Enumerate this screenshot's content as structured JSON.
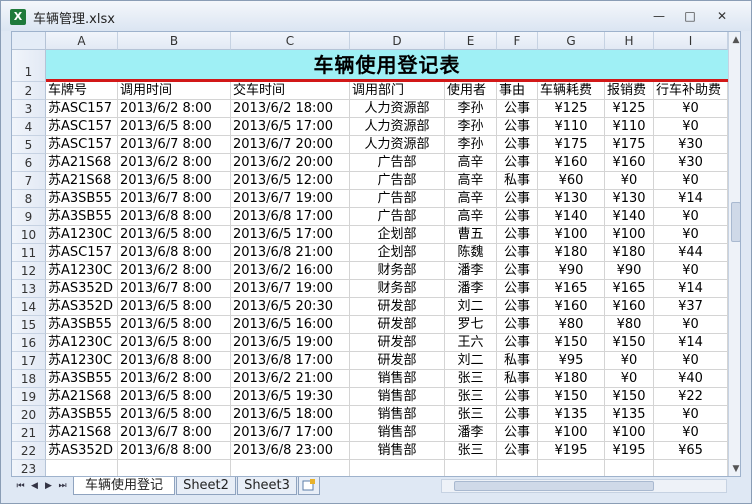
{
  "window": {
    "title": "车辆管理.xlsx",
    "app_icon": "excel-icon",
    "buttons": {
      "minimize": "—",
      "maximize": "□",
      "close": "✕"
    }
  },
  "columns": [
    "A",
    "B",
    "C",
    "D",
    "E",
    "F",
    "G",
    "H",
    "I"
  ],
  "sheet_title": "车辆使用登记表",
  "headers": [
    "车牌号",
    "调用时间",
    "交车时间",
    "调用部门",
    "使用者",
    "事由",
    "车辆耗费",
    "报销费",
    "行车补助费"
  ],
  "rows": [
    [
      "苏ASC157",
      "2013/6/2 8:00",
      "2013/6/2 18:00",
      "人力资源部",
      "李孙",
      "公事",
      "¥125",
      "¥125",
      "¥0"
    ],
    [
      "苏ASC157",
      "2013/6/5 8:00",
      "2013/6/5 17:00",
      "人力资源部",
      "李孙",
      "公事",
      "¥110",
      "¥110",
      "¥0"
    ],
    [
      "苏ASC157",
      "2013/6/7 8:00",
      "2013/6/7 20:00",
      "人力资源部",
      "李孙",
      "公事",
      "¥175",
      "¥175",
      "¥30"
    ],
    [
      "苏A21S68",
      "2013/6/2 8:00",
      "2013/6/2 20:00",
      "广告部",
      "高辛",
      "公事",
      "¥160",
      "¥160",
      "¥30"
    ],
    [
      "苏A21S68",
      "2013/6/5 8:00",
      "2013/6/5 12:00",
      "广告部",
      "高辛",
      "私事",
      "¥60",
      "¥0",
      "¥0"
    ],
    [
      "苏A3SB55",
      "2013/6/7 8:00",
      "2013/6/7 19:00",
      "广告部",
      "高辛",
      "公事",
      "¥130",
      "¥130",
      "¥14"
    ],
    [
      "苏A3SB55",
      "2013/6/8 8:00",
      "2013/6/8 17:00",
      "广告部",
      "高辛",
      "公事",
      "¥140",
      "¥140",
      "¥0"
    ],
    [
      "苏A1230C",
      "2013/6/5 8:00",
      "2013/6/5 17:00",
      "企划部",
      "曹五",
      "公事",
      "¥100",
      "¥100",
      "¥0"
    ],
    [
      "苏ASC157",
      "2013/6/8 8:00",
      "2013/6/8 21:00",
      "企划部",
      "陈魏",
      "公事",
      "¥180",
      "¥180",
      "¥44"
    ],
    [
      "苏A1230C",
      "2013/6/2 8:00",
      "2013/6/2 16:00",
      "财务部",
      "潘李",
      "公事",
      "¥90",
      "¥90",
      "¥0"
    ],
    [
      "苏AS352D",
      "2013/6/7 8:00",
      "2013/6/7 19:00",
      "财务部",
      "潘李",
      "公事",
      "¥165",
      "¥165",
      "¥14"
    ],
    [
      "苏AS352D",
      "2013/6/5 8:00",
      "2013/6/5 20:30",
      "研发部",
      "刘二",
      "公事",
      "¥160",
      "¥160",
      "¥37"
    ],
    [
      "苏A3SB55",
      "2013/6/5 8:00",
      "2013/6/5 16:00",
      "研发部",
      "罗七",
      "公事",
      "¥80",
      "¥80",
      "¥0"
    ],
    [
      "苏A1230C",
      "2013/6/5 8:00",
      "2013/6/5 19:00",
      "研发部",
      "王六",
      "公事",
      "¥150",
      "¥150",
      "¥14"
    ],
    [
      "苏A1230C",
      "2013/6/8 8:00",
      "2013/6/8 17:00",
      "研发部",
      "刘二",
      "私事",
      "¥95",
      "¥0",
      "¥0"
    ],
    [
      "苏A3SB55",
      "2013/6/2 8:00",
      "2013/6/2 21:00",
      "销售部",
      "张三",
      "私事",
      "¥180",
      "¥0",
      "¥40"
    ],
    [
      "苏A21S68",
      "2013/6/5 8:00",
      "2013/6/5 19:30",
      "销售部",
      "张三",
      "公事",
      "¥150",
      "¥150",
      "¥22"
    ],
    [
      "苏A3SB55",
      "2013/6/5 8:00",
      "2013/6/5 18:00",
      "销售部",
      "张三",
      "公事",
      "¥135",
      "¥135",
      "¥0"
    ],
    [
      "苏A21S68",
      "2013/6/7 8:00",
      "2013/6/7 17:00",
      "销售部",
      "潘李",
      "公事",
      "¥100",
      "¥100",
      "¥0"
    ],
    [
      "苏AS352D",
      "2013/6/8 8:00",
      "2013/6/8 23:00",
      "销售部",
      "张三",
      "公事",
      "¥195",
      "¥195",
      "¥65"
    ]
  ],
  "last_row_number": "23",
  "tabs": [
    "车辆使用登记",
    "Sheet2",
    "Sheet3"
  ],
  "tab_nav": [
    "⏮",
    "◀",
    "▶",
    "⏭"
  ],
  "tab_nav_icons": [
    "first-sheet-icon",
    "prev-sheet-icon",
    "next-sheet-icon",
    "last-sheet-icon"
  ],
  "new_sheet_icon": "insert-sheet-icon",
  "colors": {
    "title_fill": "#9ff0f5",
    "title_border": "#d21818"
  }
}
